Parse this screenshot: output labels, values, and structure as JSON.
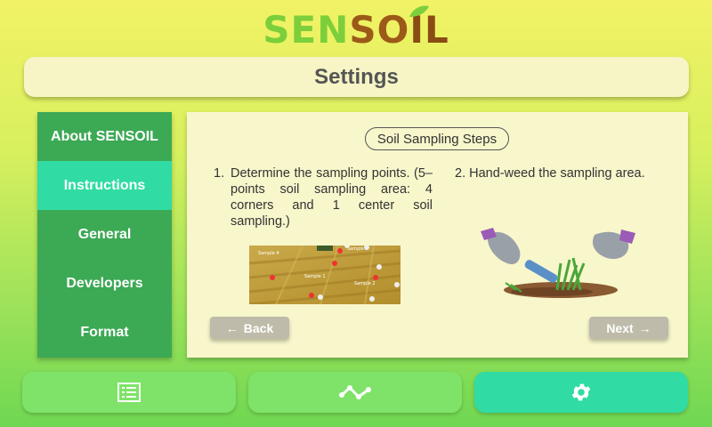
{
  "logo": {
    "part1": "SEN",
    "part2": "SO",
    "part3": "IL"
  },
  "header": {
    "title": "Settings"
  },
  "sidebar": {
    "items": [
      {
        "label": "About SENSOIL",
        "active": false
      },
      {
        "label": "Instructions",
        "active": true
      },
      {
        "label": "General",
        "active": false
      },
      {
        "label": "Developers",
        "active": false
      },
      {
        "label": "Format",
        "active": false
      }
    ]
  },
  "content": {
    "heading": "Soil Sampling Steps",
    "step1": {
      "number": "1.",
      "text": "Determine the sampling points. (5–points soil sampling area: 4 corners and 1 center soil sampling.)"
    },
    "step2": {
      "text": "2. Hand-weed the sampling area."
    },
    "field_image": {
      "labels": [
        "Sample 4",
        "Sample 3",
        "Sample 1",
        "Sample 2"
      ]
    },
    "back_button": {
      "label": "Back",
      "icon": "arrow-left-icon"
    },
    "next_button": {
      "label": "Next",
      "icon": "arrow-right-icon"
    }
  },
  "bottom_nav": {
    "items": [
      {
        "icon": "list-icon"
      },
      {
        "icon": "graph-icon"
      },
      {
        "icon": "gear-icon",
        "active": true
      }
    ]
  },
  "colors": {
    "sidebar_bg": "#3ca955",
    "active": "#30dca3",
    "panel_bg": "#f8f6cb",
    "button_gray": "#bebbaa",
    "nav_green": "#7ee368"
  }
}
